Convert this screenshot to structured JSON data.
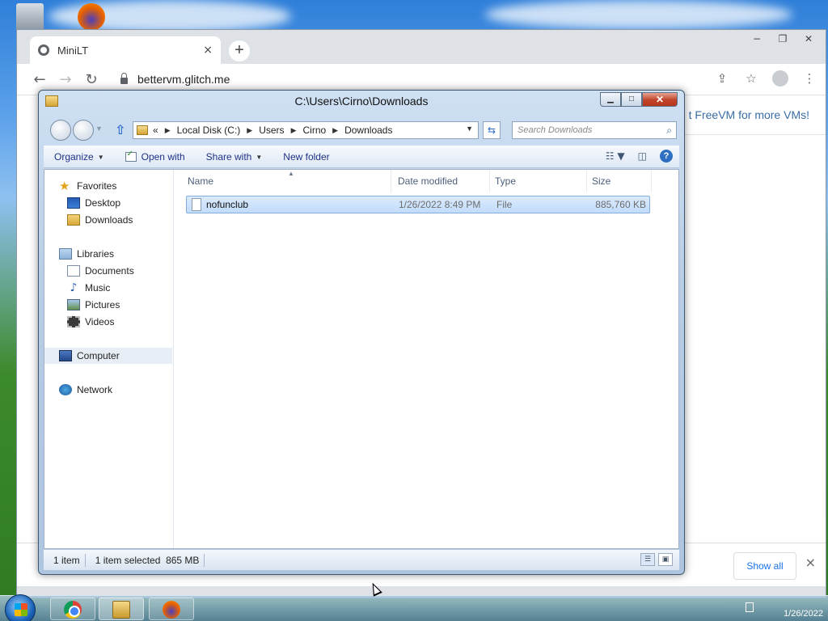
{
  "browser": {
    "tab_title": "MiniLT",
    "tab_close": "×",
    "new_tab": "+",
    "url": "bettervm.glitch.me",
    "promo_text": "t FreeVM for more VMs!",
    "download_bar": {
      "show_all": "Show all",
      "close": "×"
    },
    "window_controls": {
      "minimize": "−",
      "maximize": "❐",
      "close": "✕"
    }
  },
  "explorer": {
    "title": "C:\\Users\\Cirno\\Downloads",
    "address": {
      "overflow": "«",
      "crumbs": [
        "Local Disk (C:)",
        "Users",
        "Cirno",
        "Downloads"
      ]
    },
    "search_placeholder": "Search Downloads",
    "toolbar": {
      "organize": "Organize",
      "open_with": "Open with",
      "share_with": "Share with",
      "new_folder": "New folder"
    },
    "nav": {
      "favorites": "Favorites",
      "desktop": "Desktop",
      "downloads": "Downloads",
      "libraries": "Libraries",
      "documents": "Documents",
      "music": "Music",
      "pictures": "Pictures",
      "videos": "Videos",
      "computer": "Computer",
      "network": "Network"
    },
    "columns": {
      "name": "Name",
      "date_modified": "Date modified",
      "type": "Type",
      "size": "Size"
    },
    "files": [
      {
        "name": "nofunclub",
        "date_modified": "1/26/2022 8:49 PM",
        "type": "File",
        "size": "885,760 KB"
      }
    ],
    "status": {
      "item_count": "1 item",
      "selected": "1 item selected",
      "size": "865 MB"
    }
  },
  "taskbar": {
    "date": "1/26/2022"
  },
  "colors": {
    "explorer_frame": "#b8cde6",
    "selection": "#c1dcfb",
    "link_blue": "#1a73e8",
    "close_red": "#c0432a"
  }
}
